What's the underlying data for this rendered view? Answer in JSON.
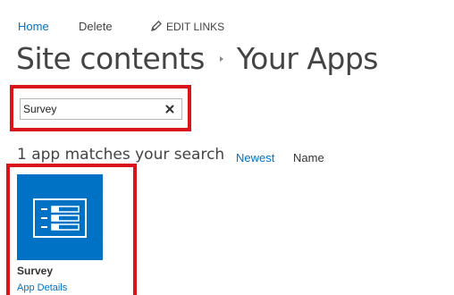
{
  "nav": {
    "home_label": "Home",
    "delete_label": "Delete",
    "edit_links_label": "EDIT LINKS"
  },
  "header": {
    "breadcrumb_root": "Site contents",
    "breadcrumb_current": "Your Apps"
  },
  "search": {
    "value": "Survey",
    "placeholder": ""
  },
  "results": {
    "count_text": "1 app matches your search",
    "sort_options": [
      "Newest",
      "Name"
    ],
    "selected_sort": "Newest"
  },
  "apps": [
    {
      "name": "Survey",
      "details_label": "App Details",
      "icon": "survey-icon"
    }
  ],
  "colors": {
    "accent": "#0072c6",
    "highlight": "#d9141b",
    "title_text": "#444444"
  }
}
